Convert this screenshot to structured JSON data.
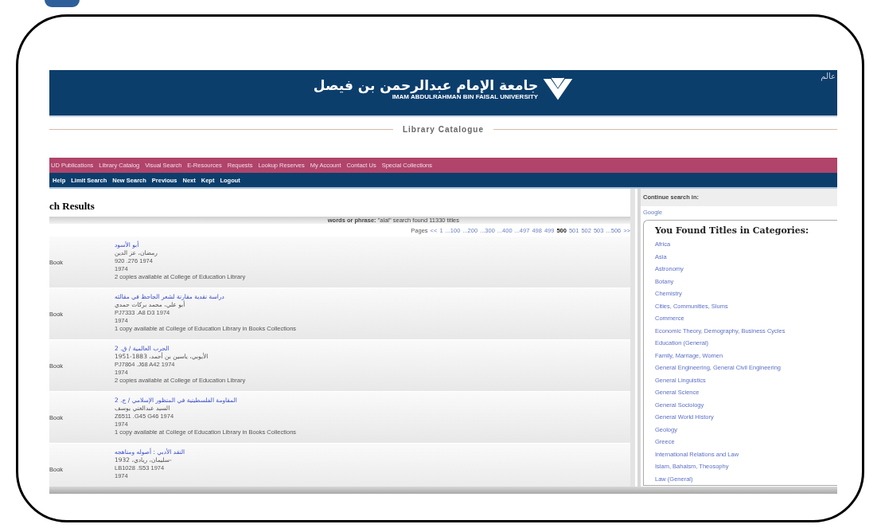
{
  "header": {
    "university_arabic": "جامعة الإمام عبدالرحمن بن فيصل",
    "university_english": "IMAM ABDULRAHMAN BIN FAISAL UNIVERSITY",
    "corner_text": "عالم"
  },
  "catalogue_title": "Library Catalogue",
  "main_nav": [
    "UD Publications",
    "Library Catalog",
    "Visual Search",
    "E-Resources",
    "Requests",
    "Lookup Reserves",
    "My Account",
    "Contact Us",
    "Special Collections"
  ],
  "sub_nav": [
    "Help",
    "Limit Search",
    "New Search",
    "Previous",
    "Next",
    "Kept",
    "Logout"
  ],
  "results": {
    "heading": "ch Results",
    "summary": "**words or phrase:** \"alal\" search found 11330 titles",
    "pages_label": "Pages",
    "pages": [
      {
        "label": "<<",
        "selected": false
      },
      {
        "label": "1",
        "selected": false
      },
      {
        "label": "...100",
        "selected": false
      },
      {
        "label": "...200",
        "selected": false
      },
      {
        "label": "...300",
        "selected": false
      },
      {
        "label": "...400",
        "selected": false
      },
      {
        "label": "...497",
        "selected": false
      },
      {
        "label": "498",
        "selected": false
      },
      {
        "label": "499",
        "selected": false
      },
      {
        "label": "500",
        "selected": true
      },
      {
        "label": "501",
        "selected": false
      },
      {
        "label": "502",
        "selected": false
      },
      {
        "label": "503",
        "selected": false
      },
      {
        "label": "...506",
        "selected": false
      },
      {
        "label": ">>",
        "selected": false
      }
    ],
    "rows": [
      {
        "format": "Book",
        "title": "أبو الأسود",
        "author": "رمضان، عز الدين",
        "call_number": "920 .276 1974",
        "year": "1974",
        "availability": "2 copies available at College of Education Library"
      },
      {
        "format": "Book",
        "title": "دراسة نقدية مقارنة لشعر الجاحظ في مقالته",
        "author": "أبو علي، محمد بركات حمدي",
        "call_number": "PJ7333 .A8 D3 1974",
        "year": "1974",
        "availability": "1 copy available at College of Education Library in Books Collections"
      },
      {
        "format": "Book",
        "title": "الحرب العالمية / ق. 2",
        "author": "الأيوبي، ياسين بن أحمد، 1883-1951",
        "call_number": "PJ7864 .J68 A42 1974",
        "year": "1974",
        "availability": "2 copies available at College of Education Library"
      },
      {
        "format": "Book",
        "title": "المقاومة الفلسطينية في المنظور الإسلامي / ج. 2",
        "author": "السيد عبدالغني يوسف",
        "call_number": "Z6511 .G45 G46 1974",
        "year": "1974",
        "availability": "1 copy available at College of Education Library in Books Collections"
      },
      {
        "format": "Book",
        "title": "النقد الأدبي : أصوله ومناهجه",
        "author": "سليمان، ريادي، 1932-",
        "call_number": "LB1028 .S53 1974",
        "year": "1974"
      }
    ]
  },
  "sidebar": {
    "continue_label": "Continue search in:",
    "continue_link": "Google",
    "categories_title": "You Found Titles in Categories:",
    "categories": [
      "Africa",
      "Asia",
      "Astronomy",
      "Botany",
      "Chemistry",
      "Cities, Communities, Slums",
      "Commerce",
      "Economic Theory, Demography, Business Cycles",
      "Education (General)",
      "Family, Marriage, Women",
      "General Engineering, General Civil Engineering",
      "General Linguistics",
      "General Science",
      "General Sociology",
      "General World History",
      "Geology",
      "Greece",
      "International Relations and Law",
      "Islam, Bahaism, Theosophy",
      "Law (General)"
    ]
  }
}
